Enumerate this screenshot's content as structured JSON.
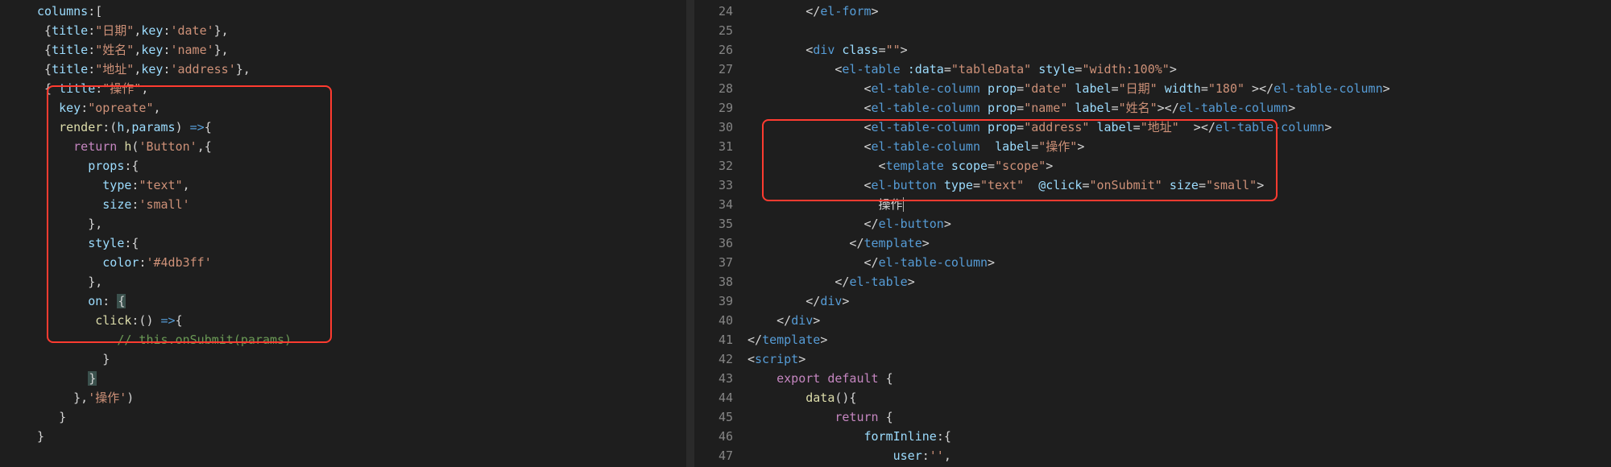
{
  "left": {
    "lines": [
      [
        [
          "prop",
          "columns"
        ],
        [
          "pun",
          ":["
        ]
      ],
      [
        [
          "pun",
          " {"
        ],
        [
          "prop",
          "title"
        ],
        [
          "pun",
          ":"
        ],
        [
          "str",
          "\"日期\""
        ],
        [
          "pun",
          ","
        ],
        [
          "prop",
          "key"
        ],
        [
          "pun",
          ":"
        ],
        [
          "str",
          "'date'"
        ],
        [
          "pun",
          "},"
        ]
      ],
      [
        [
          "pun",
          " {"
        ],
        [
          "prop",
          "title"
        ],
        [
          "pun",
          ":"
        ],
        [
          "str",
          "\"姓名\""
        ],
        [
          "pun",
          ","
        ],
        [
          "prop",
          "key"
        ],
        [
          "pun",
          ":"
        ],
        [
          "str",
          "'name'"
        ],
        [
          "pun",
          "},"
        ]
      ],
      [
        [
          "pun",
          " {"
        ],
        [
          "prop",
          "title"
        ],
        [
          "pun",
          ":"
        ],
        [
          "str",
          "\"地址\""
        ],
        [
          "pun",
          ","
        ],
        [
          "prop",
          "key"
        ],
        [
          "pun",
          ":"
        ],
        [
          "str",
          "'address'"
        ],
        [
          "pun",
          "},"
        ]
      ],
      [
        [
          "pun",
          " { "
        ],
        [
          "prop",
          "title"
        ],
        [
          "pun",
          ":"
        ],
        [
          "str",
          "\"操作\""
        ],
        [
          "pun",
          ","
        ]
      ],
      [
        [
          "pun",
          "   "
        ],
        [
          "prop",
          "key"
        ],
        [
          "pun",
          ":"
        ],
        [
          "str",
          "\"opreate\""
        ],
        [
          "pun",
          ","
        ]
      ],
      [
        [
          "pun",
          "   "
        ],
        [
          "fn",
          "render"
        ],
        [
          "pun",
          ":("
        ],
        [
          "prop",
          "h"
        ],
        [
          "pun",
          ","
        ],
        [
          "prop",
          "params"
        ],
        [
          "pun",
          ") "
        ],
        [
          "kw2",
          "=>"
        ],
        [
          "pun",
          "{"
        ]
      ],
      [
        [
          "pun",
          "     "
        ],
        [
          "kw",
          "return"
        ],
        [
          "pun",
          " "
        ],
        [
          "fn",
          "h"
        ],
        [
          "pun",
          "("
        ],
        [
          "str",
          "'Button'"
        ],
        [
          "pun",
          ",{"
        ]
      ],
      [
        [
          "pun",
          "       "
        ],
        [
          "prop",
          "props"
        ],
        [
          "pun",
          ":{"
        ]
      ],
      [
        [
          "pun",
          "         "
        ],
        [
          "prop",
          "type"
        ],
        [
          "pun",
          ":"
        ],
        [
          "str",
          "\"text\""
        ],
        [
          "pun",
          ","
        ]
      ],
      [
        [
          "pun",
          "         "
        ],
        [
          "prop",
          "size"
        ],
        [
          "pun",
          ":"
        ],
        [
          "str",
          "'small'"
        ]
      ],
      [
        [
          "pun",
          "       },"
        ]
      ],
      [
        [
          "pun",
          "       "
        ],
        [
          "prop",
          "style"
        ],
        [
          "pun",
          ":{"
        ]
      ],
      [
        [
          "pun",
          "         "
        ],
        [
          "prop",
          "color"
        ],
        [
          "pun",
          ":"
        ],
        [
          "str",
          "'#4db3ff'"
        ]
      ],
      [
        [
          "pun",
          "       },"
        ]
      ],
      [
        [
          "pun",
          "       "
        ],
        [
          "prop",
          "on"
        ],
        [
          "pun",
          ": "
        ],
        [
          "brace",
          "{"
        ]
      ],
      [
        [
          "pun",
          "        "
        ],
        [
          "fn",
          "click"
        ],
        [
          "pun",
          ":() "
        ],
        [
          "kw2",
          "=>"
        ],
        [
          "pun",
          "{"
        ]
      ],
      [
        [
          "pun",
          "           "
        ],
        [
          "comment",
          "// this.onSubmit(params)"
        ]
      ],
      [
        [
          "pun",
          "         }"
        ]
      ],
      [
        [
          "pun",
          "       "
        ],
        [
          "brace",
          "}"
        ]
      ],
      [
        [
          "pun",
          "     },"
        ],
        [
          "str",
          "'操作'"
        ],
        [
          "pun",
          ")"
        ]
      ],
      [
        [
          "pun",
          "   }"
        ]
      ],
      [
        [
          "pun",
          "}"
        ]
      ]
    ]
  },
  "right": {
    "start": 24,
    "lines": [
      [
        [
          "pun",
          "        </"
        ],
        [
          "tag",
          "el-form"
        ],
        [
          "pun",
          ">"
        ]
      ],
      [
        [
          "pun",
          ""
        ]
      ],
      [
        [
          "pun",
          "        <"
        ],
        [
          "tag",
          "div"
        ],
        [
          "pun",
          " "
        ],
        [
          "attr",
          "class"
        ],
        [
          "pun",
          "="
        ],
        [
          "str",
          "\"\""
        ],
        [
          "pun",
          ">"
        ]
      ],
      [
        [
          "pun",
          "            <"
        ],
        [
          "tag",
          "el-table"
        ],
        [
          "pun",
          " "
        ],
        [
          "attr",
          ":data"
        ],
        [
          "pun",
          "="
        ],
        [
          "str",
          "\"tableData\""
        ],
        [
          "pun",
          " "
        ],
        [
          "attr",
          "style"
        ],
        [
          "pun",
          "="
        ],
        [
          "str",
          "\"width:100%\""
        ],
        [
          "pun",
          ">"
        ]
      ],
      [
        [
          "pun",
          "                <"
        ],
        [
          "tag",
          "el-table-column"
        ],
        [
          "pun",
          " "
        ],
        [
          "attr",
          "prop"
        ],
        [
          "pun",
          "="
        ],
        [
          "str",
          "\"date\""
        ],
        [
          "pun",
          " "
        ],
        [
          "attr",
          "label"
        ],
        [
          "pun",
          "="
        ],
        [
          "str",
          "\"日期\""
        ],
        [
          "pun",
          " "
        ],
        [
          "attr",
          "width"
        ],
        [
          "pun",
          "="
        ],
        [
          "str",
          "\"180\""
        ],
        [
          "pun",
          " ></"
        ],
        [
          "tag",
          "el-table-column"
        ],
        [
          "pun",
          ">"
        ]
      ],
      [
        [
          "pun",
          "                <"
        ],
        [
          "tag",
          "el-table-column"
        ],
        [
          "pun",
          " "
        ],
        [
          "attr",
          "prop"
        ],
        [
          "pun",
          "="
        ],
        [
          "str",
          "\"name\""
        ],
        [
          "pun",
          " "
        ],
        [
          "attr",
          "label"
        ],
        [
          "pun",
          "="
        ],
        [
          "str",
          "\"姓名\""
        ],
        [
          "pun",
          "></"
        ],
        [
          "tag",
          "el-table-column"
        ],
        [
          "pun",
          ">"
        ]
      ],
      [
        [
          "pun",
          "                <"
        ],
        [
          "tag",
          "el-table-column"
        ],
        [
          "pun",
          " "
        ],
        [
          "attr",
          "prop"
        ],
        [
          "pun",
          "="
        ],
        [
          "str",
          "\"address\""
        ],
        [
          "pun",
          " "
        ],
        [
          "attr",
          "label"
        ],
        [
          "pun",
          "="
        ],
        [
          "str",
          "\"地址\""
        ],
        [
          "pun",
          "  ></"
        ],
        [
          "tag",
          "el-table-column"
        ],
        [
          "pun",
          ">"
        ]
      ],
      [
        [
          "pun",
          "                <"
        ],
        [
          "tag",
          "el-table-column"
        ],
        [
          "pun",
          "  "
        ],
        [
          "attr",
          "label"
        ],
        [
          "pun",
          "="
        ],
        [
          "str",
          "\"操作\""
        ],
        [
          "pun",
          ">"
        ]
      ],
      [
        [
          "pun",
          "                  <"
        ],
        [
          "tag",
          "template"
        ],
        [
          "pun",
          " "
        ],
        [
          "attr",
          "scope"
        ],
        [
          "pun",
          "="
        ],
        [
          "str",
          "\"scope\""
        ],
        [
          "pun",
          ">"
        ]
      ],
      [
        [
          "pun",
          "                <"
        ],
        [
          "tag",
          "el-button"
        ],
        [
          "pun",
          " "
        ],
        [
          "attr",
          "type"
        ],
        [
          "pun",
          "="
        ],
        [
          "str",
          "\"text\""
        ],
        [
          "pun",
          "  "
        ],
        [
          "attr",
          "@click"
        ],
        [
          "pun",
          "="
        ],
        [
          "str",
          "\"onSubmit\""
        ],
        [
          "pun",
          " "
        ],
        [
          "attr",
          "size"
        ],
        [
          "pun",
          "="
        ],
        [
          "str",
          "\"small\""
        ],
        [
          "pun",
          ">"
        ]
      ],
      [
        [
          "pun",
          "                  操作"
        ],
        [
          "cursor",
          "|"
        ]
      ],
      [
        [
          "pun",
          "                </"
        ],
        [
          "tag",
          "el-button"
        ],
        [
          "pun",
          ">"
        ]
      ],
      [
        [
          "pun",
          "              </"
        ],
        [
          "tag",
          "template"
        ],
        [
          "pun",
          ">"
        ]
      ],
      [
        [
          "pun",
          "                </"
        ],
        [
          "tag",
          "el-table-column"
        ],
        [
          "pun",
          ">"
        ]
      ],
      [
        [
          "pun",
          "            </"
        ],
        [
          "tag",
          "el-table"
        ],
        [
          "pun",
          ">"
        ]
      ],
      [
        [
          "pun",
          "        </"
        ],
        [
          "tag",
          "div"
        ],
        [
          "pun",
          ">"
        ]
      ],
      [
        [
          "pun",
          "    </"
        ],
        [
          "tag",
          "div"
        ],
        [
          "pun",
          ">"
        ]
      ],
      [
        [
          "pun",
          "</"
        ],
        [
          "tag",
          "template"
        ],
        [
          "pun",
          ">"
        ]
      ],
      [
        [
          "pun",
          "<"
        ],
        [
          "tag",
          "script"
        ],
        [
          "pun",
          ">"
        ]
      ],
      [
        [
          "pun",
          "    "
        ],
        [
          "kw",
          "export"
        ],
        [
          "pun",
          " "
        ],
        [
          "kw",
          "default"
        ],
        [
          "pun",
          " {"
        ]
      ],
      [
        [
          "pun",
          "        "
        ],
        [
          "fn",
          "data"
        ],
        [
          "pun",
          "(){"
        ]
      ],
      [
        [
          "pun",
          "            "
        ],
        [
          "kw",
          "return"
        ],
        [
          "pun",
          " {"
        ]
      ],
      [
        [
          "pun",
          "                "
        ],
        [
          "prop",
          "formInline"
        ],
        [
          "pun",
          ":{"
        ]
      ],
      [
        [
          "pun",
          "                    "
        ],
        [
          "prop",
          "user"
        ],
        [
          "pun",
          ":"
        ],
        [
          "str",
          "''"
        ],
        [
          "pun",
          ","
        ]
      ]
    ]
  }
}
